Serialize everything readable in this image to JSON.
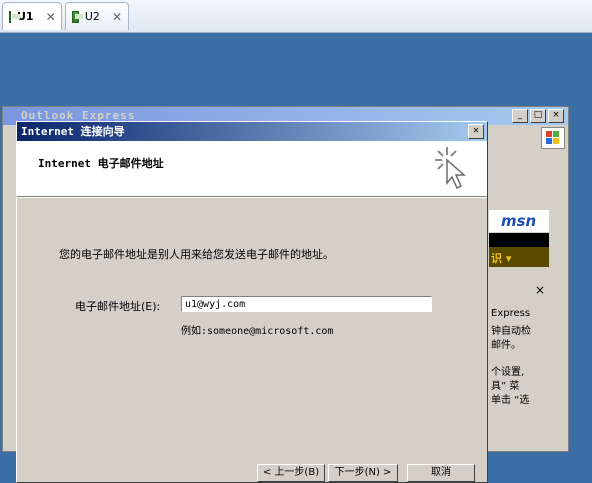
{
  "tabs": [
    {
      "label": "U1",
      "active": true
    },
    {
      "label": "U2",
      "active": false
    }
  ],
  "outlook": {
    "title": "Outlook Express",
    "window_buttons": [
      "_",
      "□",
      "×"
    ],
    "side_text": {
      "msn": "msn",
      "bar": "识 ▾",
      "close": "×",
      "lines": [
        "Express",
        "钟自动检",
        "邮件。",
        "个设置,",
        "具” 菜",
        "单击 “选"
      ]
    }
  },
  "wizard": {
    "title": "Internet 连接向导",
    "header_title": "Internet 电子邮件地址",
    "description": "您的电子邮件地址是别人用来给您发送电子邮件的地址。",
    "email_label": "电子邮件地址(E):",
    "email_value": "u1@wyj.com",
    "example": "例如:someone@microsoft.com",
    "buttons": {
      "back": "< 上一步(B)",
      "next": "下一步(N) >",
      "cancel": "取消"
    }
  }
}
